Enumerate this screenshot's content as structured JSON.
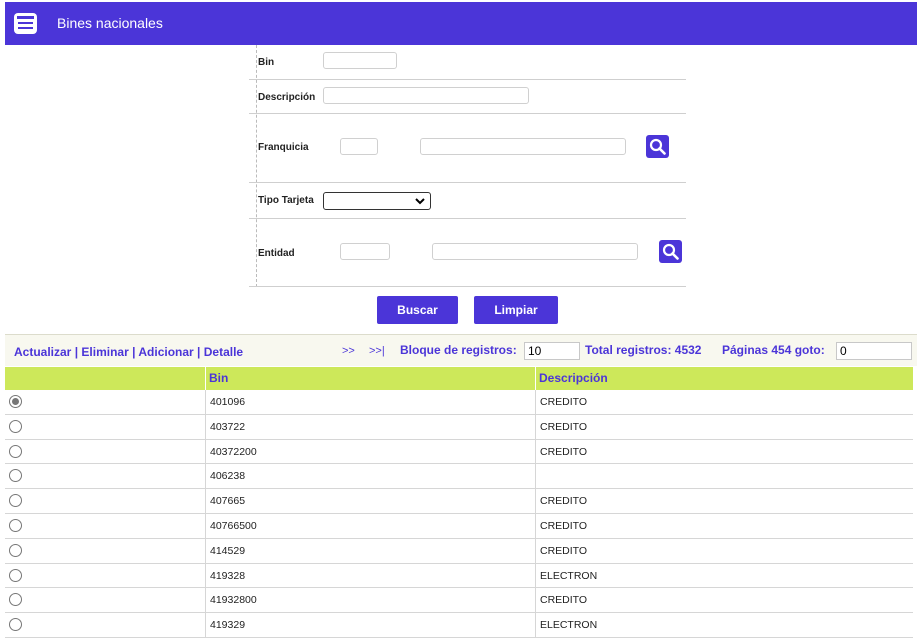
{
  "header": {
    "title": "Bines nacionales",
    "icon": "list-card-icon"
  },
  "form": {
    "bin_label": "Bin",
    "bin_value": "",
    "descripcion_label": "Descripción",
    "descripcion_value": "",
    "franquicia_label": "Franquicia",
    "franquicia_code": "",
    "franquicia_name": "",
    "tipo_tarjeta_label": "Tipo Tarjeta",
    "tipo_tarjeta_value": "",
    "entidad_label": "Entidad",
    "entidad_code": "",
    "entidad_name": ""
  },
  "buttons": {
    "buscar": "Buscar",
    "limpiar": "Limpiar"
  },
  "toolbar": {
    "actualizar": "Actualizar",
    "sep": "|",
    "eliminar": "Eliminar",
    "adicionar": "Adicionar",
    "detalle": "Detalle",
    "next": ">>",
    "last": ">>|",
    "bloque_label": "Bloque de registros:",
    "bloque_value": "10",
    "total_label": "Total registros: 4532",
    "paginas_label": "Páginas 454 goto:",
    "goto_value": "0"
  },
  "table": {
    "columns": [
      "",
      "Bin",
      "Descripción"
    ],
    "rows": [
      {
        "selected": true,
        "bin": "401096",
        "descripcion": "CREDITO"
      },
      {
        "selected": false,
        "bin": "403722",
        "descripcion": "CREDITO"
      },
      {
        "selected": false,
        "bin": "40372200",
        "descripcion": "CREDITO"
      },
      {
        "selected": false,
        "bin": "406238",
        "descripcion": ""
      },
      {
        "selected": false,
        "bin": "407665",
        "descripcion": "CREDITO"
      },
      {
        "selected": false,
        "bin": "40766500",
        "descripcion": "CREDITO"
      },
      {
        "selected": false,
        "bin": "414529",
        "descripcion": "CREDITO"
      },
      {
        "selected": false,
        "bin": "419328",
        "descripcion": "ELECTRON"
      },
      {
        "selected": false,
        "bin": "41932800",
        "descripcion": "CREDITO"
      },
      {
        "selected": false,
        "bin": "419329",
        "descripcion": "ELECTRON"
      }
    ]
  },
  "colors": {
    "primary": "#4b35d8",
    "header_row": "#cde85a",
    "toolbar_bg": "#f8f8ef"
  }
}
